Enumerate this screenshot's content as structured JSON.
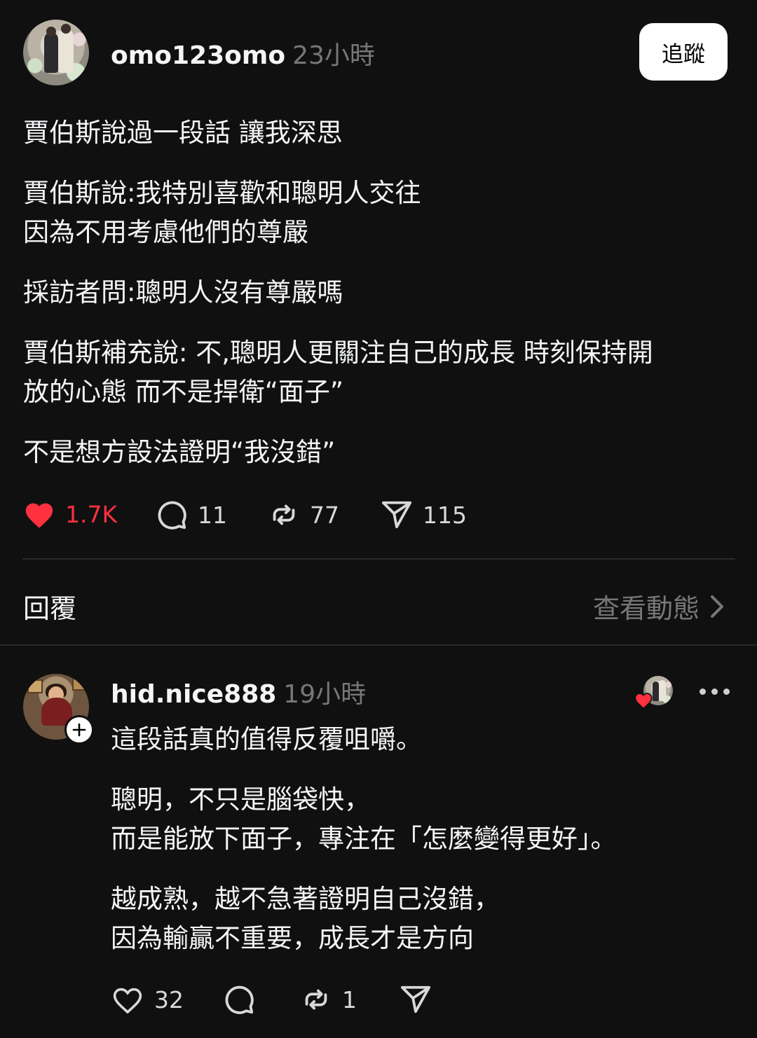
{
  "post": {
    "username": "omo123omo",
    "time": "23小時",
    "follow_label": "追蹤",
    "paragraphs": [
      "賈伯斯說過一段話 讓我深思",
      "賈伯斯說:我特別喜歡和聰明人交往\n因為不用考慮他們的尊嚴",
      "採訪者問:聰明人沒有尊嚴嗎",
      "賈伯斯補充說: 不,聰明人更關注自己的成長 時刻保持開\n放的心態 而不是捍衛“面子”",
      "不是想方設法證明“我沒錯”"
    ],
    "likes": "1.7K",
    "comments": "11",
    "reposts": "77",
    "shares": "115",
    "liked": true
  },
  "replies_header": {
    "title": "回覆",
    "view_activity": "查看動態"
  },
  "reply": {
    "username": "hid.nice888",
    "time": "19小時",
    "paragraphs": [
      "這段話真的值得反覆咀嚼。",
      "聰明，不只是腦袋快，\n而是能放下面子，專注在「怎麼變得更好」。",
      "越成熟，越不急著證明自己沒錯，\n因為輸贏不重要，成長才是方向"
    ],
    "likes": "32",
    "reposts": "1"
  },
  "colors": {
    "background": "#101010",
    "heart": "#ff3040",
    "muted": "#777777"
  }
}
